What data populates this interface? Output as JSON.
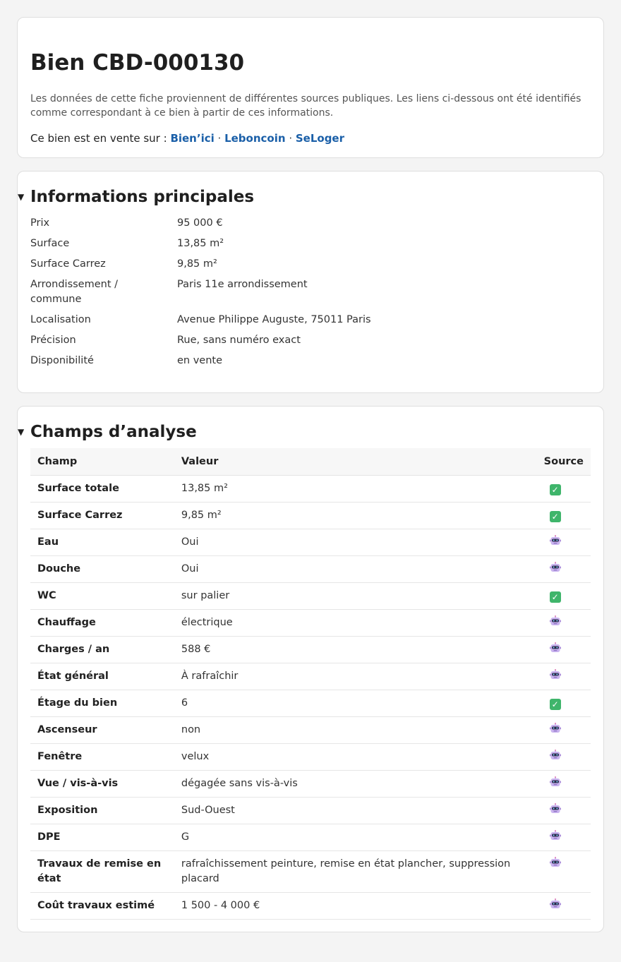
{
  "header": {
    "title": "Bien CBD-000130",
    "intro": "Les données de cette fiche proviennent de différentes sources publiques. Les liens ci-dessous ont été identifiés comme correspondant à ce bien à partir de ces informations.",
    "sale_prefix": "Ce bien est en vente sur : ",
    "links": [
      "Bien’ici",
      "Leboncoin",
      "SeLoger"
    ],
    "separator": " · "
  },
  "info": {
    "title": "Informations principales",
    "rows": [
      {
        "label": "Prix",
        "value": "95 000 €"
      },
      {
        "label": "Surface",
        "value": "13,85 m²"
      },
      {
        "label": "Surface Carrez",
        "value": "9,85 m²"
      },
      {
        "label": "Arrondissement / commune",
        "value": "Paris 11e arrondissement"
      },
      {
        "label": "Localisation",
        "value": "Avenue Philippe Auguste, 75011 Paris"
      },
      {
        "label": "Précision",
        "value": "Rue, sans numéro exact"
      },
      {
        "label": "Disponibilité",
        "value": "en vente"
      }
    ]
  },
  "fields": {
    "title": "Champs d’analyse",
    "columns": [
      "Champ",
      "Valeur",
      "Source"
    ],
    "rows": [
      {
        "name": "Surface totale",
        "value": "13,85 m²",
        "source": "check-icon"
      },
      {
        "name": "Surface Carrez",
        "value": "9,85 m²",
        "source": "check-icon"
      },
      {
        "name": "Eau",
        "value": "Oui",
        "source": "robot-icon"
      },
      {
        "name": "Douche",
        "value": "Oui",
        "source": "robot-icon"
      },
      {
        "name": "WC",
        "value": "sur palier",
        "source": "check-icon"
      },
      {
        "name": "Chauffage",
        "value": "électrique",
        "source": "robot-icon"
      },
      {
        "name": "Charges / an",
        "value": "588 €",
        "source": "robot-icon"
      },
      {
        "name": "État général",
        "value": "À rafraîchir",
        "source": "robot-icon"
      },
      {
        "name": "Étage du bien",
        "value": "6",
        "source": "check-icon"
      },
      {
        "name": "Ascenseur",
        "value": "non",
        "source": "robot-icon"
      },
      {
        "name": "Fenêtre",
        "value": "velux",
        "source": "robot-icon"
      },
      {
        "name": "Vue / vis-à-vis",
        "value": "dégagée sans vis-à-vis",
        "source": "robot-icon"
      },
      {
        "name": "Exposition",
        "value": "Sud-Ouest",
        "source": "robot-icon"
      },
      {
        "name": "DPE",
        "value": "G",
        "source": "robot-icon"
      },
      {
        "name": "Travaux de remise en état",
        "value": "rafraîchissement peinture, remise en état plancher, suppression placard",
        "source": "robot-icon"
      },
      {
        "name": "Coût travaux estimé",
        "value": "1 500 - 4 000 €",
        "source": "robot-icon"
      }
    ]
  },
  "colors": {
    "link": "#1a5fa8",
    "check": "#3fb56b",
    "robot": "#b39ddb"
  }
}
